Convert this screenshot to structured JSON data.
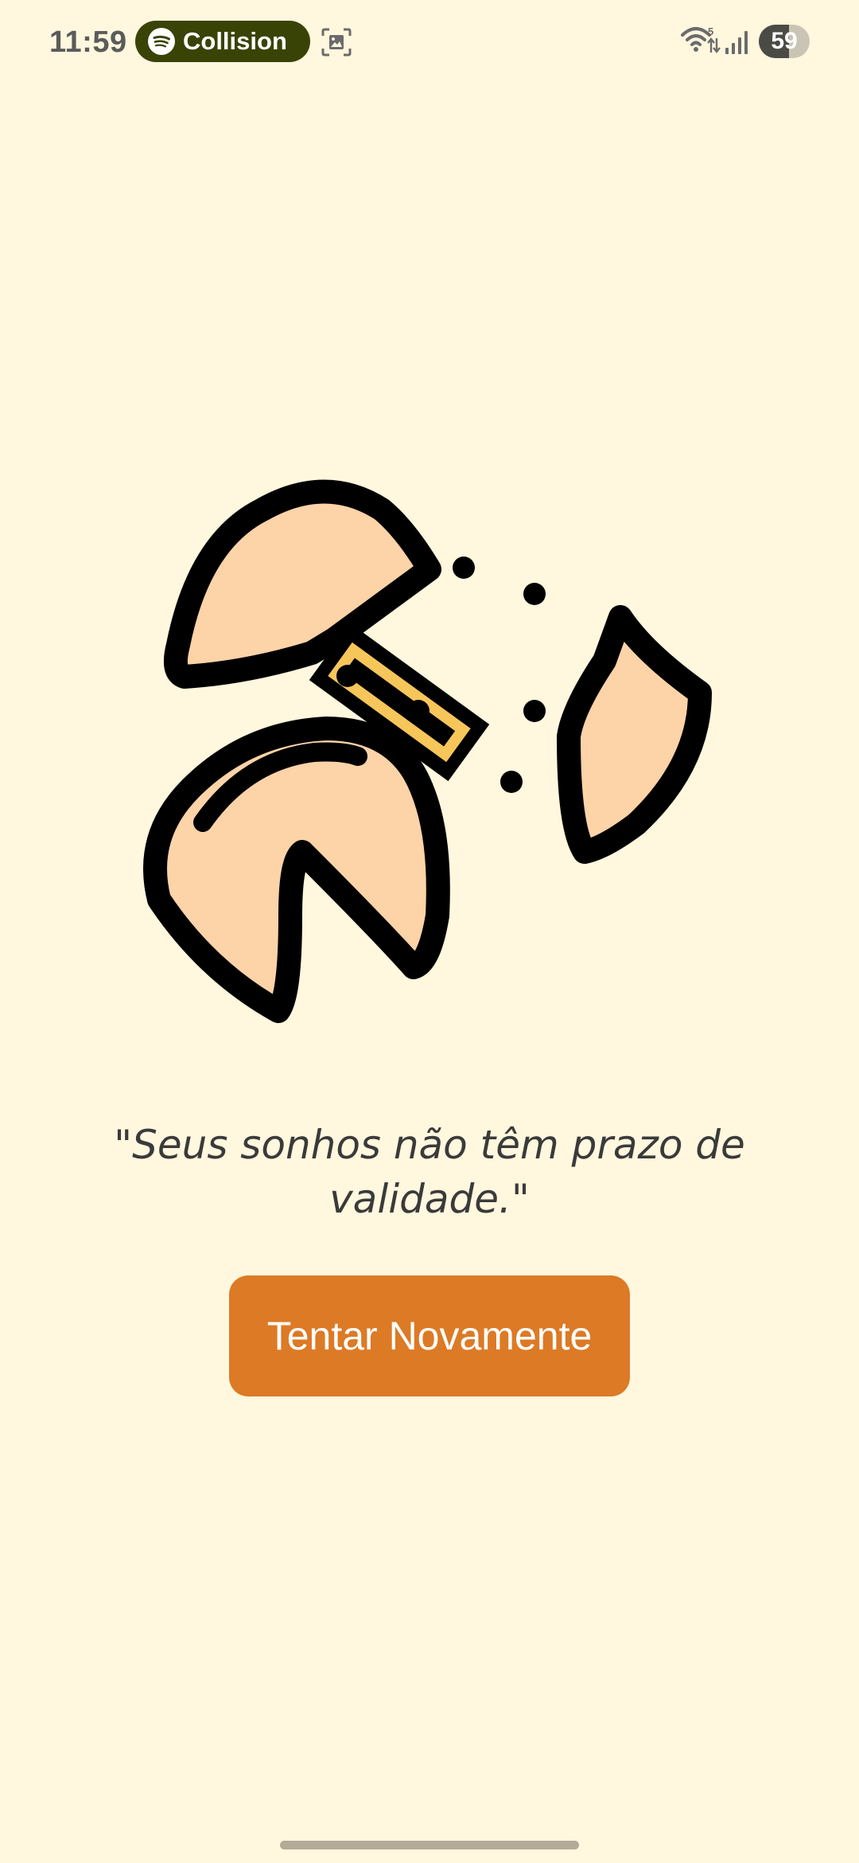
{
  "status_bar": {
    "time": "11:59",
    "media": {
      "app_icon": "spotify-icon",
      "title": "Collision"
    },
    "screenshot_icon": "screenshot-icon",
    "wifi_icon": "wifi-icon",
    "signal_icon": "signal-icon",
    "battery": {
      "level": "59",
      "fraction": 0.59
    }
  },
  "illustration": {
    "name": "broken-fortune-cookie",
    "colors": {
      "cookie": "#FDD3A8",
      "paper": "#F7C65A",
      "outline": "#000000"
    }
  },
  "fortune": {
    "text": "\"Seus sonhos não têm prazo de validade.\""
  },
  "actions": {
    "retry_label": "Tentar Novamente"
  },
  "theme": {
    "background": "#FFF7DE",
    "accent": "#DC7A26",
    "text": "#3A3A3A"
  }
}
